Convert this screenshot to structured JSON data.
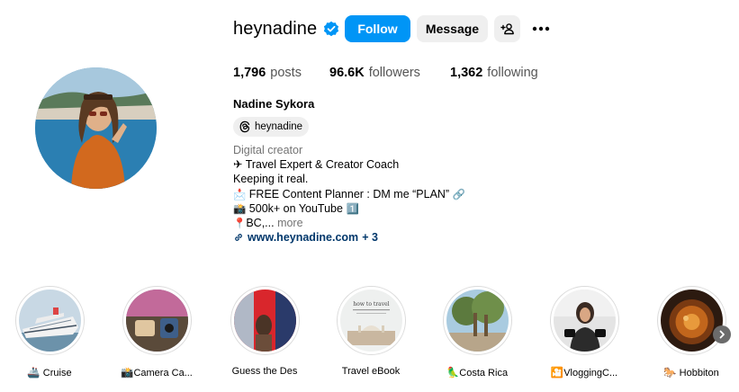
{
  "profile": {
    "username": "heynadine",
    "verified": true,
    "follow_label": "Follow",
    "message_label": "Message",
    "full_name": "Nadine Sykora",
    "threads_handle": "heynadine"
  },
  "stats": {
    "posts_count": "1,796",
    "posts_label": "posts",
    "followers_count": "96.6K",
    "followers_label": "followers",
    "following_count": "1,362",
    "following_label": "following"
  },
  "bio": {
    "category": "Digital creator",
    "line1": "✈ Travel Expert & Creator Coach",
    "line2": "Keeping it real.",
    "line3_icon": "📩",
    "line3": " FREE Content Planner : DM me “PLAN” ",
    "line3_end": "🔗",
    "line4_icon": "📸",
    "line4": " 500k+ on YouTube ",
    "line4_end": "1️⃣",
    "line5_icon": "📍",
    "line5": "BC,... ",
    "more_label": "more",
    "link_text": "www.heynadine.com",
    "link_extra": "+ 3"
  },
  "highlights": [
    {
      "emoji": "🚢",
      "label": "Cruise"
    },
    {
      "emoji": "📸",
      "label": "Camera Ca..."
    },
    {
      "emoji": "",
      "label": "Guess the Des"
    },
    {
      "emoji": "",
      "label": "Travel eBook"
    },
    {
      "emoji": "🦜",
      "label": "Costa Rica"
    },
    {
      "emoji": "🎦",
      "label": "VloggingC..."
    },
    {
      "emoji": "🐎",
      "label": "Hobbiton"
    }
  ],
  "ebook_cover_text": "how to travel",
  "colors": {
    "accent": "#0095f6",
    "button_gray": "#efefef",
    "link": "#00376b",
    "muted": "#737373"
  }
}
